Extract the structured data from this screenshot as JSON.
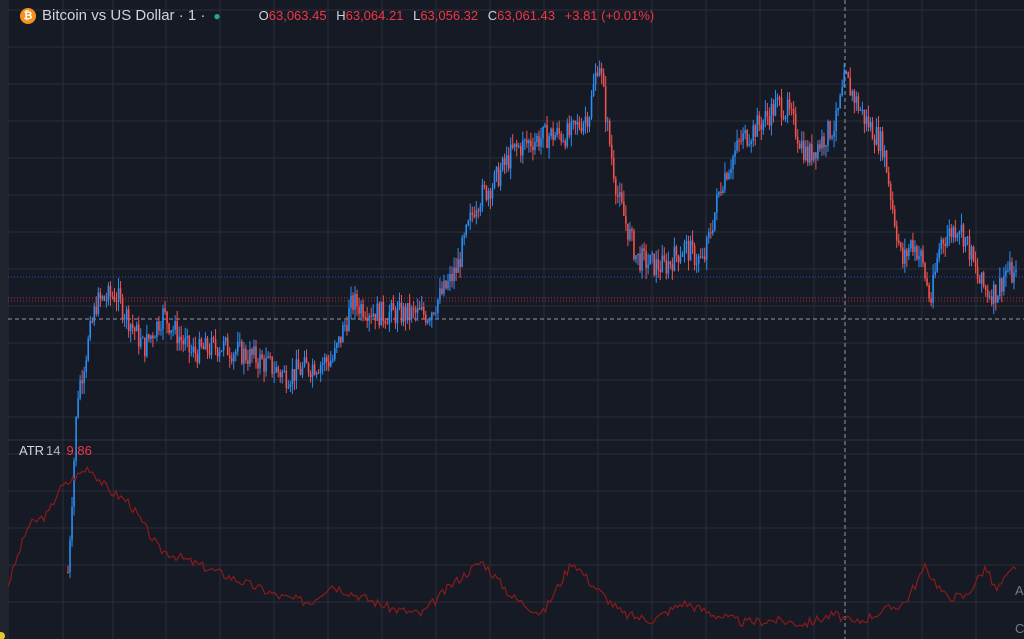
{
  "legend": {
    "coin_glyph": "₿",
    "title": "Bitcoin vs US Dollar · 1 ·",
    "status_glyph": "●",
    "o_key": "O",
    "open": "63,063.45",
    "h_key": "H",
    "high": "63,064.21",
    "l_key": "L",
    "low": "63,056.32",
    "c_key": "C",
    "close": "63,061.43",
    "change": "+3.81 (+0.01%)"
  },
  "indicator": {
    "name": "ATR",
    "length": "14",
    "value": "9.86"
  },
  "edge": {
    "a": "A",
    "c": "C"
  },
  "colors": {
    "background": "#161a25",
    "grid": "#2a2e39",
    "up": "#2a8ef5",
    "down": "#f0524e",
    "atr": "#8b1a1a"
  },
  "icons": [
    "bitcoin-icon",
    "market-status-dot-icon",
    "notification-dot-icon"
  ],
  "chart_data": {
    "type": "candlestick",
    "up_color": "#2a8ef5",
    "down_color": "#f0524e",
    "close_path": [
      [
        0,
        62800
      ],
      [
        0.01,
        62958
      ],
      [
        0.03,
        63040
      ],
      [
        0.05,
        63048
      ],
      [
        0.08,
        63000
      ],
      [
        0.1,
        63030
      ],
      [
        0.13,
        62995
      ],
      [
        0.16,
        63002
      ],
      [
        0.2,
        62990
      ],
      [
        0.23,
        62975
      ],
      [
        0.26,
        62985
      ],
      [
        0.28,
        62990
      ],
      [
        0.3,
        63040
      ],
      [
        0.33,
        63030
      ],
      [
        0.36,
        63030
      ],
      [
        0.38,
        63030
      ],
      [
        0.4,
        63055
      ],
      [
        0.41,
        63070
      ],
      [
        0.43,
        63130
      ],
      [
        0.45,
        63148
      ],
      [
        0.47,
        63176
      ],
      [
        0.49,
        63185
      ],
      [
        0.51,
        63190
      ],
      [
        0.53,
        63190
      ],
      [
        0.55,
        63210
      ],
      [
        0.56,
        63260
      ],
      [
        0.57,
        63190
      ],
      [
        0.58,
        63135
      ],
      [
        0.6,
        63080
      ],
      [
        0.62,
        63073
      ],
      [
        0.63,
        63073
      ],
      [
        0.65,
        63090
      ],
      [
        0.67,
        63075
      ],
      [
        0.69,
        63150
      ],
      [
        0.71,
        63185
      ],
      [
        0.73,
        63200
      ],
      [
        0.75,
        63218
      ],
      [
        0.76,
        63210
      ],
      [
        0.78,
        63170
      ],
      [
        0.8,
        63190
      ],
      [
        0.81,
        63200
      ],
      [
        0.82,
        63240
      ],
      [
        0.84,
        63205
      ],
      [
        0.86,
        63180
      ],
      [
        0.87,
        63125
      ],
      [
        0.88,
        63075
      ],
      [
        0.89,
        63095
      ],
      [
        0.9,
        63080
      ],
      [
        0.91,
        63040
      ],
      [
        0.92,
        63095
      ],
      [
        0.94,
        63110
      ],
      [
        0.95,
        63090
      ],
      [
        0.96,
        63060
      ],
      [
        0.97,
        63050
      ],
      [
        0.98,
        63050
      ],
      [
        0.99,
        63070
      ],
      [
        1,
        63061
      ]
    ],
    "atr_path": [
      [
        0,
        4
      ],
      [
        0.02,
        9
      ],
      [
        0.04,
        10
      ],
      [
        0.05,
        12
      ],
      [
        0.08,
        14
      ],
      [
        0.1,
        12
      ],
      [
        0.12,
        11
      ],
      [
        0.15,
        7
      ],
      [
        0.18,
        6
      ],
      [
        0.21,
        5
      ],
      [
        0.24,
        4
      ],
      [
        0.27,
        3
      ],
      [
        0.3,
        2.5
      ],
      [
        0.32,
        4
      ],
      [
        0.35,
        3
      ],
      [
        0.38,
        2
      ],
      [
        0.41,
        1.5
      ],
      [
        0.44,
        4
      ],
      [
        0.47,
        6
      ],
      [
        0.5,
        3
      ],
      [
        0.53,
        1.5
      ],
      [
        0.56,
        6
      ],
      [
        0.58,
        4
      ],
      [
        0.61,
        1.5
      ],
      [
        0.64,
        1
      ],
      [
        0.67,
        2.5
      ],
      [
        0.7,
        1.5
      ],
      [
        0.73,
        0.8
      ],
      [
        0.76,
        1
      ],
      [
        0.79,
        0.7
      ],
      [
        0.82,
        1.5
      ],
      [
        0.84,
        0.7
      ],
      [
        0.86,
        1.5
      ],
      [
        0.89,
        2.5
      ],
      [
        0.91,
        5.5
      ],
      [
        0.93,
        3
      ],
      [
        0.95,
        3
      ],
      [
        0.97,
        5.5
      ],
      [
        0.98,
        3.5
      ],
      [
        1,
        5.6
      ]
    ]
  }
}
